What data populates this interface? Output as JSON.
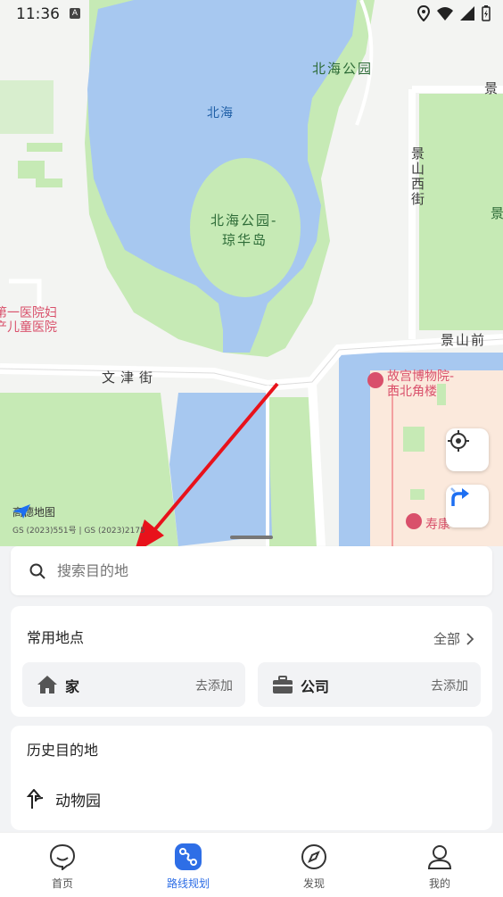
{
  "status_bar": {
    "time": "11:36",
    "icons": [
      "a-icon",
      "location-icon",
      "wifi-icon",
      "signal-icon",
      "battery-icon"
    ]
  },
  "map": {
    "labels": {
      "beihai_park": "北海公园",
      "beihai": "北海",
      "qionghua_island": "北海公园-琼华岛",
      "qionghua_line1": "北海公园-",
      "qionghua_line2": "琼华岛",
      "jingshan_west": "景山西街",
      "jingshan_front": "景山前",
      "jing": "景",
      "jing2": "景",
      "wenjin": "文津街",
      "hospital_line1": "第一医院妇",
      "hospital_line2": "产儿童医院",
      "museum_line1": "故宫博物院-",
      "museum_line2": "西北角楼",
      "shoukang": "寿康"
    },
    "logo_text": "高德地图",
    "copyright": "GS (2023)551号 | GS (2023)2175",
    "colors": {
      "water": "#a7c8f0",
      "green": "#c6eab5",
      "road": "#ffffff",
      "palace": "#fbe9dc",
      "arrow": "#e8121b"
    }
  },
  "search": {
    "placeholder": "搜索目的地"
  },
  "favorites": {
    "title": "常用地点",
    "all_label": "全部",
    "home_label": "家",
    "home_action": "去添加",
    "company_label": "公司",
    "company_action": "去添加"
  },
  "history": {
    "title": "历史目的地",
    "items": [
      "动物园"
    ]
  },
  "tabs": [
    {
      "label": "首页",
      "icon": "home-chat-icon"
    },
    {
      "label": "路线规划",
      "icon": "route-icon",
      "active": true
    },
    {
      "label": "发现",
      "icon": "compass-icon"
    },
    {
      "label": "我的",
      "icon": "profile-icon"
    }
  ]
}
